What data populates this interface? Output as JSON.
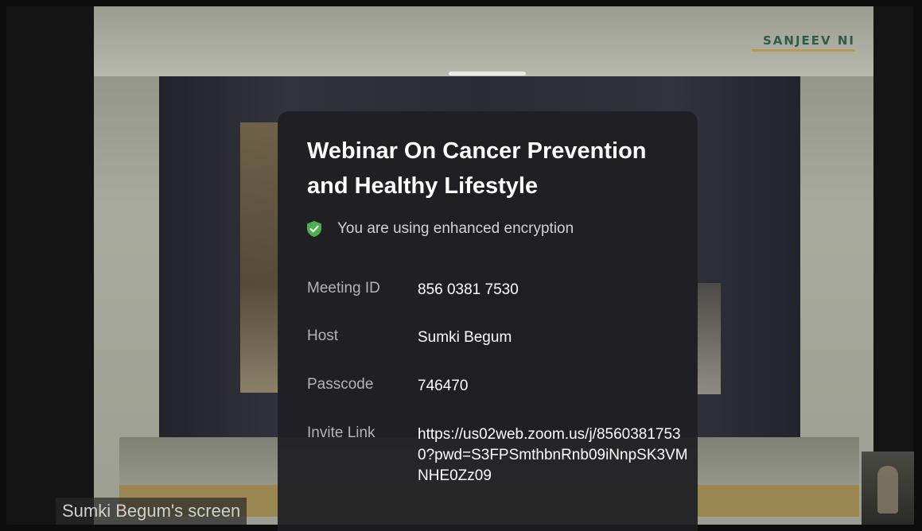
{
  "slide": {
    "logo_text": "SANJEEV  NI"
  },
  "meeting": {
    "title": "Webinar On Cancer Prevention and Healthy Lifestyle",
    "encryption_text": "You are using enhanced encryption",
    "details": [
      {
        "label": "Meeting ID",
        "value": "856 0381 7530"
      },
      {
        "label": "Host",
        "value": "Sumki Begum"
      },
      {
        "label": "Passcode",
        "value": "746470"
      },
      {
        "label": "Invite Link",
        "value": "https://us02web.zoom.us/j/85603817530?pwd=S3FPSmthbnRnb09iNnpSK3VMNHE0Zz09"
      }
    ]
  },
  "screen_share": {
    "label": "Sumki Begum's screen"
  },
  "colors": {
    "shield": "#4caf50",
    "panel_bg": "#1e1e22"
  }
}
